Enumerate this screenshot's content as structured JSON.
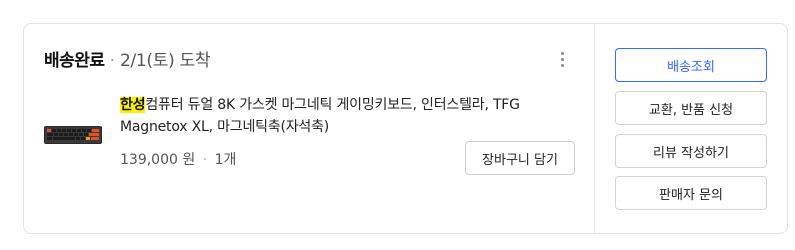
{
  "order": {
    "status": "배송완료",
    "separator": "·",
    "date": "2/1(토) 도착"
  },
  "product": {
    "brand_highlight": "한성",
    "title_rest": "컴퓨터 듀얼 8K 가스켓 마그네틱 게이밍키보드, 인터스텔라, TFG Magnetox XL, 마그네틱축(자석축)",
    "price": "139,000 원",
    "price_separator": "·",
    "quantity": "1개",
    "add_to_cart_label": "장바구니 담기"
  },
  "actions": [
    {
      "label": "배송조회"
    },
    {
      "label": "교환, 반품 신청"
    },
    {
      "label": "리뷰 작성하기"
    },
    {
      "label": "판매자 문의"
    }
  ],
  "icons": {
    "more": "more-vertical-icon",
    "thumbnail": "keyboard-thumbnail"
  },
  "colors": {
    "primary": "#346aff",
    "highlight": "#ffef00",
    "border": "#e3e3e3"
  }
}
